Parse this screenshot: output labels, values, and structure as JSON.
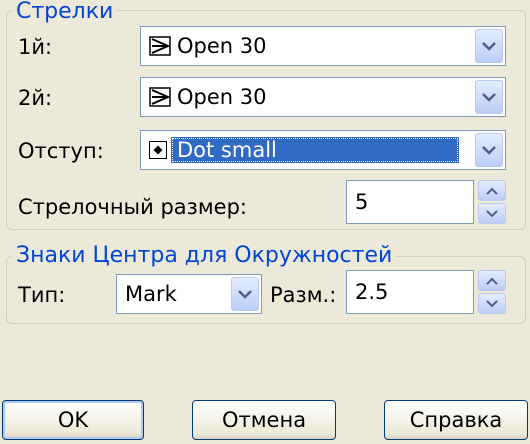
{
  "arrows": {
    "group_title": "Стрелки",
    "first": {
      "label": "1й:",
      "value": "Open 30",
      "icon": "open-arrow-icon"
    },
    "second": {
      "label": "2й:",
      "value": "Open 30",
      "icon": "open-arrow-icon"
    },
    "leader": {
      "label": "Отступ:",
      "value": "Dot small",
      "icon": "dot-icon"
    },
    "size": {
      "label": "Стрелочный размер:",
      "value": "5"
    }
  },
  "center_marks": {
    "group_title": "Знаки Центра для Окружностей",
    "type_label": "Тип:",
    "type_value": "Mark",
    "size_label": "Разм.:",
    "size_value": "2.5"
  },
  "buttons": {
    "ok": "OK",
    "cancel": "Отмена",
    "help": "Справка"
  },
  "colors": {
    "accent": "#0046d5",
    "selection": "#316ac5",
    "background": "#ece9d8"
  }
}
